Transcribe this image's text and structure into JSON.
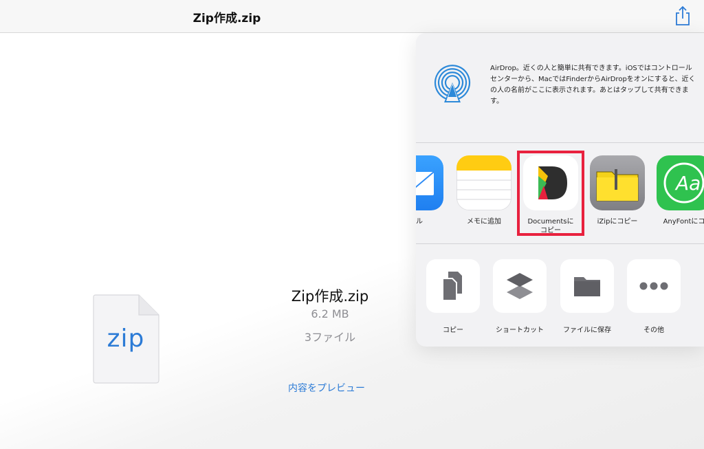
{
  "navbar": {
    "title": "Zip作成.zip",
    "share_icon": "share-icon"
  },
  "file": {
    "icon_text": "zip",
    "name": "Zip作成.zip",
    "size": "6.2 MB",
    "count": "3ファイル",
    "preview_link": "内容をプレビュー"
  },
  "share_sheet": {
    "airdrop_text": "AirDrop。近くの人と簡単に共有できます。iOSではコントロールセンターから、MacではFinderからAirDropをオンにすると、近くの人の名前がここに表示されます。あとはタップして共有できます。",
    "apps": [
      {
        "label": "ール",
        "icon": "mail-icon"
      },
      {
        "label": "メモに追加",
        "icon": "notes-icon"
      },
      {
        "label": "Documentsに\nコピー",
        "icon": "documents-icon"
      },
      {
        "label": "iZipにコピー",
        "icon": "izip-icon"
      },
      {
        "label": "AnyFontにコ",
        "icon": "anyfont-icon"
      }
    ],
    "actions": [
      {
        "label": "コピー",
        "icon": "copy-icon"
      },
      {
        "label": "ショートカット",
        "icon": "shortcuts-icon"
      },
      {
        "label": "ファイルに保存",
        "icon": "folder-icon"
      },
      {
        "label": "その他",
        "icon": "more-icon"
      }
    ],
    "colors": {
      "highlight": "#e8213e",
      "accent": "#2c7bd6"
    }
  }
}
